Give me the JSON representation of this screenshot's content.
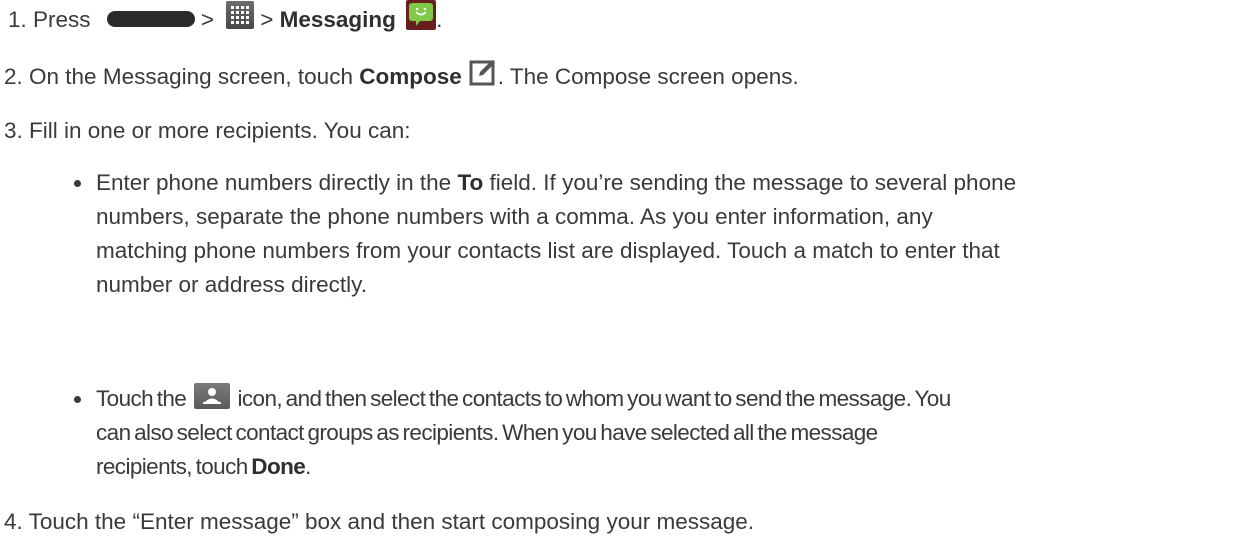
{
  "steps": [
    {
      "num": "1.",
      "text_a": "Press",
      "sep1": ">",
      "sep2": ">",
      "bold": "Messaging",
      "end": "."
    },
    {
      "num": "2.",
      "text_a": "On the Messaging screen, touch ",
      "bold": "Compose",
      "text_b": ". The Compose screen opens."
    },
    {
      "num": "3.",
      "text": "Fill in one or more recipients. You can:"
    },
    {
      "num": "4.",
      "text": "Touch the “Enter message” box and then start composing your message."
    }
  ],
  "bullets": {
    "first": {
      "l1a": "Enter phone numbers directly in the ",
      "l1b": "To",
      "l1c": " field. If you’re sending the message to several phone",
      "l2": "numbers, separate the phone numbers with a comma. As you enter information, any",
      "l3": "matching phone numbers from your contacts list are displayed. Touch a match to enter that",
      "l4": "number or address directly."
    },
    "second": {
      "l1a": "Touch the ",
      "l1b": " icon, and then select the contacts to whom you want to send the message. You",
      "l2": "can also select contact groups as recipients. When you have selected all the message",
      "l3a": "recipients, touch ",
      "l3b": "Done",
      "l3c": "."
    }
  },
  "icons": {
    "home": "home-button-icon",
    "apps": "apps-grid-icon",
    "messaging": "messaging-app-icon",
    "compose": "compose-icon",
    "contacts": "contacts-icon"
  },
  "colors": {
    "text": "#3a3a3a",
    "messaging_bg": "#6a1f1f",
    "messaging_bubble": "#7fc84a"
  }
}
